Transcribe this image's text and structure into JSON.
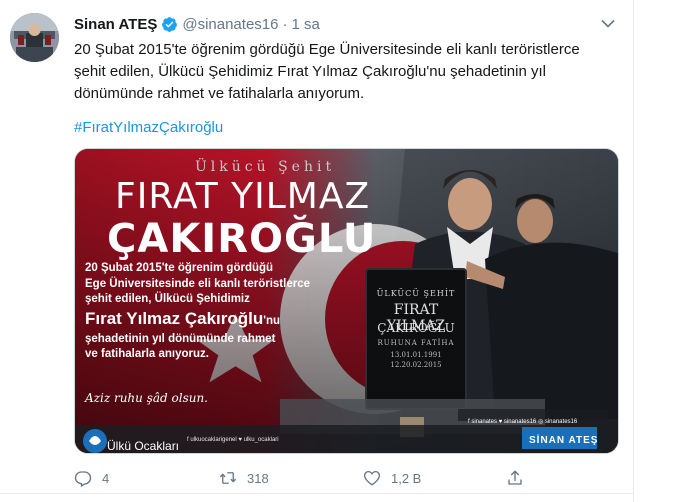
{
  "tweet": {
    "display_name": "Sinan ATEŞ",
    "handle": "@sinanates16",
    "separator": "·",
    "time": "1 sa",
    "text_lines": [
      "20 Şubat 2015'te öğrenim gördüğü Ege Üniversitesinde eli kanlı teröristlerce",
      "şehit edilen, Ülkücü Şehidimiz Fırat Yılmaz Çakıroğlu'nu şehadetinin yıl",
      "dönümünde rahmet ve fatihalarla anıyorum."
    ],
    "hashtag": "#FıratYılmazÇakıroğlu"
  },
  "media": {
    "kicker": "Ülkücü Şehit",
    "name_line1": "FIRAT YILMAZ",
    "name_line2": "ÇAKIROĞLU",
    "body_lines": [
      "20 Şubat 2015'te öğrenim gördüğü",
      "Ege Üniversitesinde eli kanlı teröristlerce",
      "şehit edilen, Ülkücü Şehidimiz"
    ],
    "body_name": "Fırat Yılmaz Çakıroğlu",
    "body_name_suffix": "'nu",
    "body_lines2": [
      "şehadetinin yıl dönümünde rahmet",
      "ve fatihalarla anıyoruz."
    ],
    "signature": "Aziz ruhu şâd olsun.",
    "stone": {
      "l1": "ÜLKÜCÜ ŞEHİT",
      "l2": "FIRAT YILMAZ",
      "l3": "ÇAKIROĞLU",
      "l4": "RUHUNA FATİHA",
      "l5": "13.01.01.1991",
      "l6": "12.20.02.2015"
    },
    "org_name": "Ülkü Ocakları",
    "socials_left": "f ulkuocaklarigenel  ♥ ulku_ocaklari",
    "socials_right": "f sinanates   ♥ sinanates16   ◎ sinanates16",
    "brand": "SİNAN ATEŞ"
  },
  "actions": {
    "reply_count": "4",
    "retweet_count": "318",
    "like_count": "1,2 B"
  },
  "colors": {
    "link": "#1b95e0",
    "verified": "#1da1f2",
    "muted": "#657786",
    "flag_red": "#c8102e"
  },
  "icons": {
    "verified": "verified-badge-icon",
    "caret": "chevron-down-icon",
    "reply": "reply-icon",
    "retweet": "retweet-icon",
    "like": "heart-icon",
    "share": "share-icon"
  }
}
